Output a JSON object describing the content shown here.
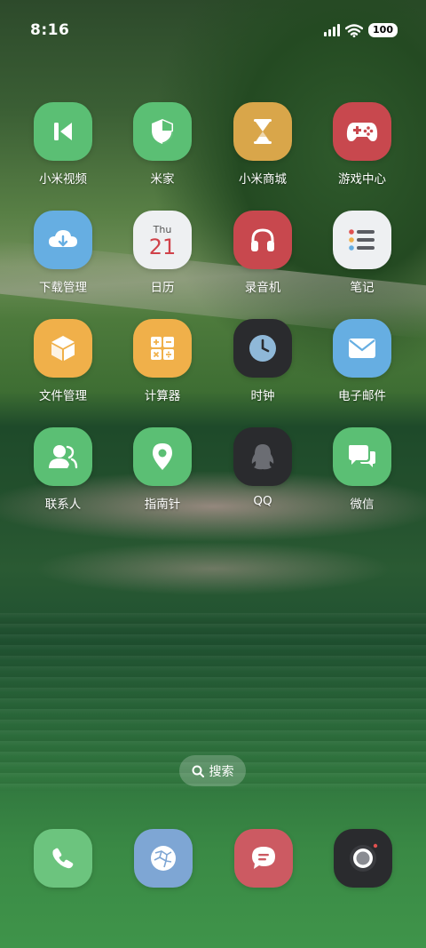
{
  "status": {
    "time": "8:16",
    "battery": "100"
  },
  "apps": {
    "mi_video": "小米视频",
    "mi_home": "米家",
    "mi_store": "小米商城",
    "game_center": "游戏中心",
    "downloads": "下载管理",
    "calendar": "日历",
    "calendar_weekday": "Thu",
    "calendar_date": "21",
    "recorder": "录音机",
    "notes": "笔记",
    "file_manager": "文件管理",
    "calculator": "计算器",
    "clock": "时钟",
    "email": "电子邮件",
    "contacts": "联系人",
    "compass": "指南针",
    "qq": "QQ",
    "wechat": "微信"
  },
  "search": {
    "label": "搜索"
  },
  "dock": {
    "phone": "phone-icon",
    "browser": "browser-icon",
    "messages": "messages-icon",
    "camera": "camera-icon"
  },
  "colors": {
    "green": "#5bbf74",
    "mustard": "#d9a64a",
    "red": "#c8484e",
    "sky": "#66aee2",
    "light": "#eef0f2",
    "orange": "#f0b04a",
    "dark": "#2a2b2e"
  }
}
